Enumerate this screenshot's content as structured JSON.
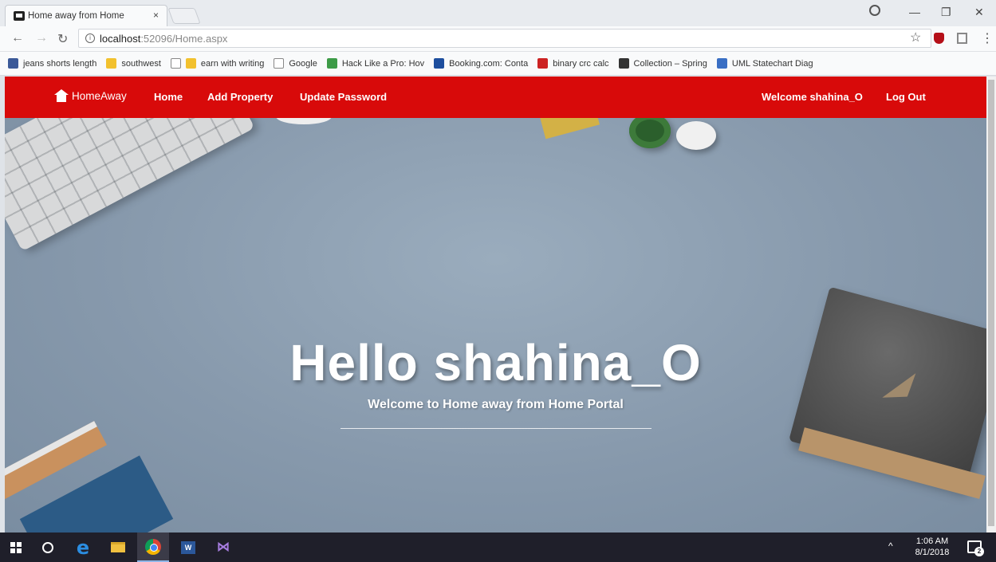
{
  "browser": {
    "tab_title": "Home away from Home",
    "tab_close": "×",
    "url_host": "localhost",
    "url_path": ":52096/Home.aspx",
    "bookmarks": [
      {
        "label": "jeans shorts length",
        "color": "#3b5998"
      },
      {
        "label": "southwest",
        "color": "#f2c12e"
      },
      {
        "label": "earn with writing",
        "color": "#f2c12e"
      },
      {
        "label": "Google",
        "color": "#e0e0e0"
      },
      {
        "label": "Hack Like a Pro: Hov",
        "color": "#3d9b47"
      },
      {
        "label": "Booking.com: Conta",
        "color": "#1d4e9e"
      },
      {
        "label": "binary crc calc",
        "color": "#cc2222"
      },
      {
        "label": "Collection – Spring",
        "color": "#333333"
      },
      {
        "label": "UML Statechart Diag",
        "color": "#3a6fc4"
      }
    ]
  },
  "navbar": {
    "brand": "HomeAway",
    "home": "Home",
    "add_property": "Add Property",
    "update_password": "Update Password",
    "welcome": "Welcome shahina_O",
    "logout": "Log Out",
    "color": "#d80a0a"
  },
  "hero": {
    "title": "Hello shahina_O",
    "subtitle": "Welcome to Home away from Home Portal"
  },
  "taskbar": {
    "time": "1:06 AM",
    "date": "8/1/2018",
    "notifications": "2"
  }
}
